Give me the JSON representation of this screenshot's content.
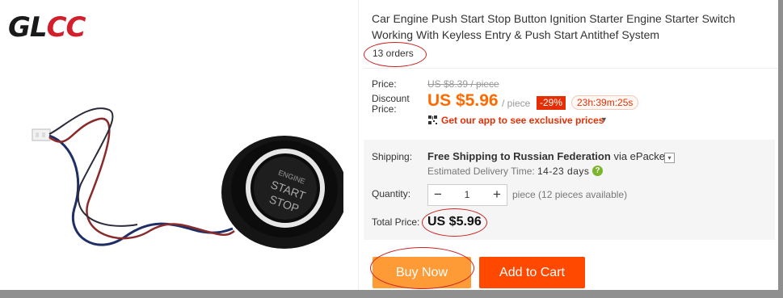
{
  "logo": {
    "text_a": "GL",
    "text_b": "CC"
  },
  "product": {
    "title": "Car Engine Push Start Stop Button Ignition Starter Engine Starter Switch Working With Keyless Entry & Push Start Antithef System",
    "orders": "13 orders",
    "image_alt": "Engine Start Stop push button with wiring harness",
    "button_text": [
      "ENGINE",
      "START",
      "STOP"
    ]
  },
  "pricing": {
    "price_label": "Price:",
    "old_price": "US $8.39 / piece",
    "discount_label": "Discount Price:",
    "price": "US $5.96",
    "per_unit": "/ piece",
    "discount_pct": "-29%",
    "countdown": "23h:39m:25s",
    "app_promo": "Get our app to see exclusive prices"
  },
  "shipping": {
    "label": "Shipping:",
    "method_bold": "Free Shipping to Russian Federation",
    "method_via": "via ePacket",
    "est_label": "Estimated Delivery Time:",
    "est_days": "14-23 days",
    "help_icon": "?"
  },
  "quantity": {
    "label": "Quantity:",
    "minus": "−",
    "value": "1",
    "plus": "+",
    "available": "piece (12 pieces available)"
  },
  "total": {
    "label": "Total Price:",
    "value": "US $5.96"
  },
  "actions": {
    "buy_now": "Buy Now",
    "add_to_cart": "Add to Cart"
  },
  "colors": {
    "accent": "#ff6a00",
    "buy": "#ff9b37",
    "cart": "#ff4800",
    "annotation": "#cc2222"
  }
}
